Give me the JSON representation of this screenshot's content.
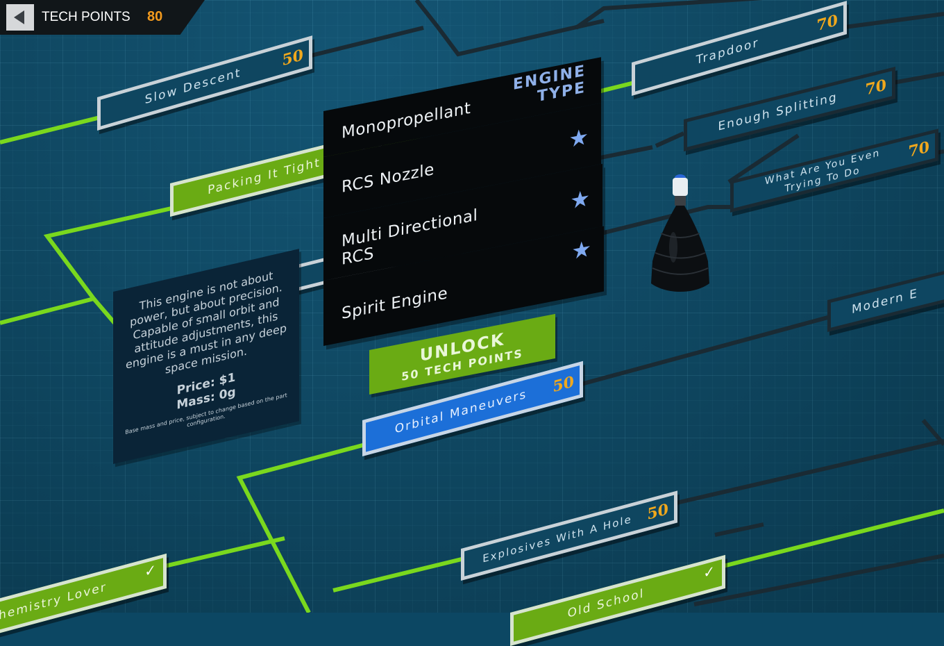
{
  "header": {
    "tech_points_label": "TECH POINTS",
    "tech_points_value": "80"
  },
  "menu": {
    "header_line1": "ENGINE",
    "header_line2": "TYPE",
    "items": [
      {
        "label": "Monopropellant",
        "starred": false
      },
      {
        "label": "RCS Nozzle",
        "starred": true
      },
      {
        "label": "Multi Directional RCS",
        "starred": true
      },
      {
        "label": "Spirit Engine",
        "starred": true
      }
    ],
    "star_icon": "★"
  },
  "unlock": {
    "title": "UNLOCK",
    "cost_text": "50 TECH POINTS"
  },
  "info": {
    "description": "This engine is not about power, but about precision. Capable of small orbit and attitude adjustments, this engine is a must in any deep space mission.",
    "price": "Price: $1",
    "mass": "Mass: 0g",
    "note": "Base mass and price, subject to change based on the part configuration."
  },
  "nodes": [
    {
      "id": "slow-descent",
      "label": "Slow Descent",
      "cost": "50",
      "state": "available"
    },
    {
      "id": "trapdoor",
      "label": "Trapdoor",
      "cost": "70",
      "state": "available"
    },
    {
      "id": "enough-splitting",
      "label": "Enough Splitting",
      "cost": "70",
      "state": "locked"
    },
    {
      "id": "what-are-you",
      "label": "What Are You Even Trying To Do",
      "cost": "70",
      "state": "locked"
    },
    {
      "id": "packing-it-tight",
      "label": "Packing It Tight",
      "cost": "",
      "state": "unlocked"
    },
    {
      "id": "modern",
      "label": "Modern E",
      "cost": "",
      "state": "locked"
    },
    {
      "id": "orbital-maneuvers",
      "label": "Orbital Maneuvers",
      "cost": "50",
      "state": "selected"
    },
    {
      "id": "explosives",
      "label": "Explosives With A Hole",
      "cost": "50",
      "state": "available"
    },
    {
      "id": "chemistry-lover",
      "label": "Chemistry Lover",
      "cost": "",
      "state": "unlocked"
    },
    {
      "id": "old-school",
      "label": "Old School",
      "cost": "",
      "state": "unlocked"
    }
  ],
  "checkmark_icon": "✓",
  "colors": {
    "background": "#0d4a66",
    "unlocked_green": "#6aab14",
    "selected_blue": "#1c6fd8",
    "cost_orange": "#f0a81d",
    "active_line": "#7ad81e",
    "inactive_line": "#1a2a33",
    "tech_points_orange": "#f29a1e"
  }
}
